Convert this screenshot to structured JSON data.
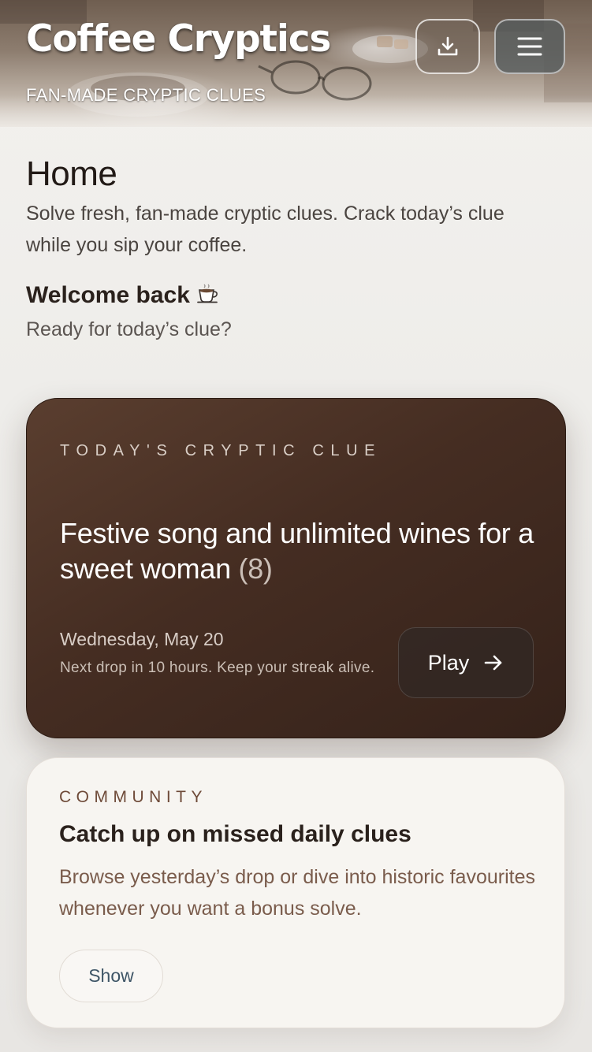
{
  "header": {
    "title": "Coffee Cryptics",
    "subtitle": "FAN-MADE CRYPTIC CLUES",
    "download_icon": "download-icon",
    "menu_icon": "hamburger-menu-icon"
  },
  "home": {
    "title": "Home",
    "intro": "Solve fresh, fan-made cryptic clues. Crack today’s clue while you sip your coffee.",
    "welcome_title": "Welcome back",
    "welcome_icon": "coffee-cup-icon",
    "welcome_subtitle": "Ready for today’s clue?"
  },
  "clue_card": {
    "eyebrow": "TODAY'S CRYPTIC CLUE",
    "clue": "Festive song and unlimited wines for a sweet woman",
    "letter_count": "(8)",
    "date": "Wednesday, May 20",
    "next_drop": "Next drop in 10 hours. Keep your streak alive.",
    "play_label": "Play",
    "play_icon": "arrow-right-icon"
  },
  "community_card": {
    "eyebrow": "COMMUNITY",
    "title": "Catch up on missed daily clues",
    "body": "Browse yesterday’s drop or dive into historic favourites whenever you want a bonus solve.",
    "show_label": "Show"
  },
  "colors": {
    "clue_card_bg": "#452d22",
    "community_eyebrow": "#6e4a38",
    "show_button_text": "#3e5566"
  }
}
